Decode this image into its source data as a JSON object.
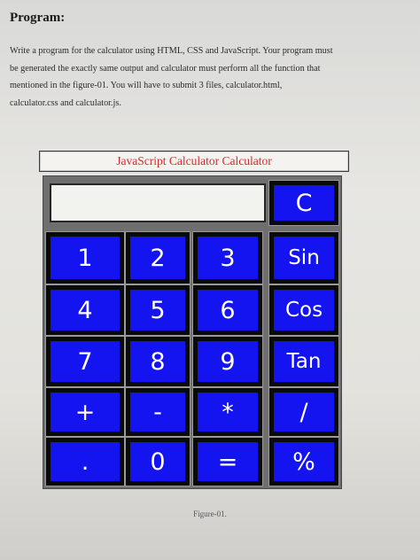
{
  "heading": "Program:",
  "paragraph": {
    "line1": "Write a program for the calculator using HTML, CSS and JavaScript. Your program must",
    "line2": "be generated the exactly same output and calculator must perform all the function that",
    "line3": "mentioned in the figure-01. You will have to submit 3 files, calculator.html,",
    "line4": "calculator.css and calculator.js."
  },
  "calculator": {
    "title": "JavaScript Calculator Calculator",
    "display_value": "",
    "buttons": {
      "clear": "C",
      "one": "1",
      "two": "2",
      "three": "3",
      "sin": "Sin",
      "four": "4",
      "five": "5",
      "six": "6",
      "cos": "Cos",
      "seven": "7",
      "eight": "8",
      "nine": "9",
      "tan": "Tan",
      "plus": "+",
      "minus": "-",
      "multiply": "*",
      "divide": "/",
      "dot": ".",
      "zero": "0",
      "equals": "=",
      "percent": "%"
    }
  },
  "caption": "Figure-01.",
  "colors": {
    "button_blue": "#1414f0",
    "title_red": "#d62b2b"
  }
}
